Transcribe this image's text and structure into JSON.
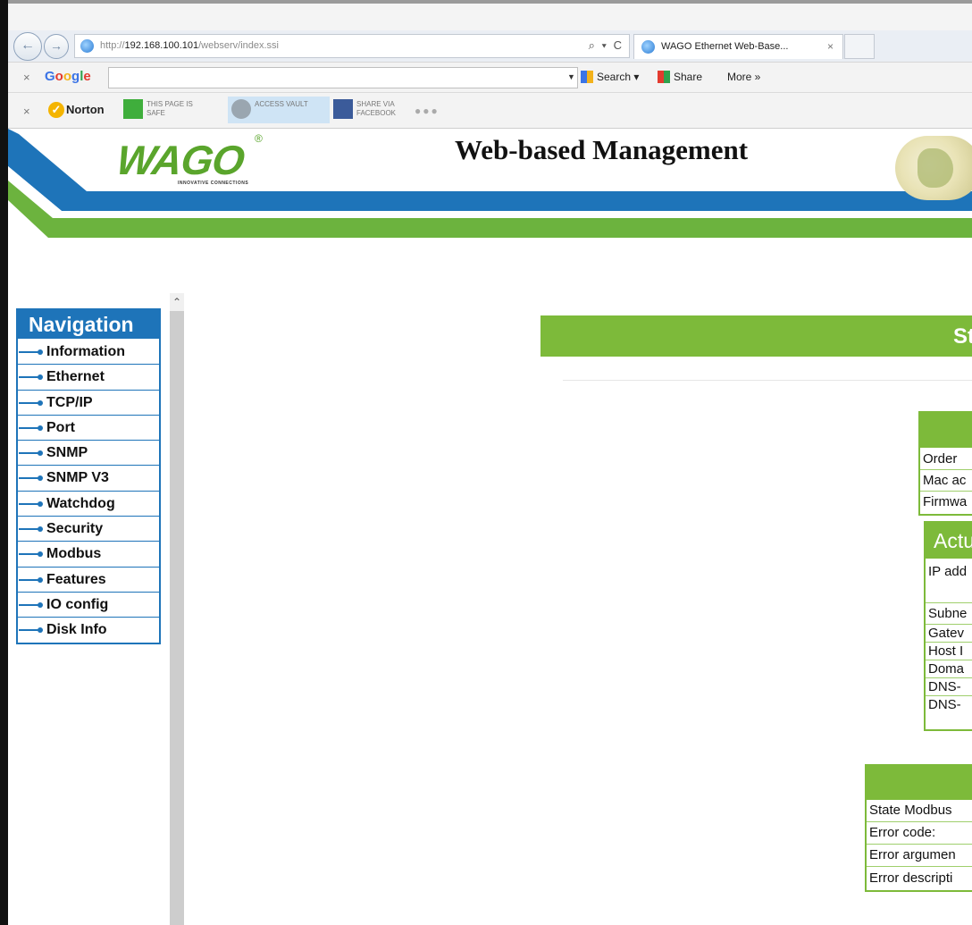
{
  "browser": {
    "url_prefix": "http://",
    "url_host": "192.168.100.101",
    "url_path": "/webserv/index.ssi",
    "url_controls": "⌕ ▾ C",
    "tab_title": "WAGO Ethernet Web-Base...",
    "tab_close": "×",
    "google_logo": [
      "G",
      "o",
      "o",
      "g",
      "l",
      "e"
    ],
    "google_search": "Search",
    "google_share": "Share",
    "google_more": "More »",
    "norton_label": "Norton",
    "norton_safe": "THIS PAGE IS SAFE",
    "norton_vault": "ACCESS VAULT",
    "norton_facebook": "SHARE VIA FACEBOOK",
    "close_x": "×"
  },
  "header": {
    "logo": "WAGO",
    "logo_reg": "®",
    "tagline": "INNOVATIVE CONNECTIONS",
    "title": "Web-based Management"
  },
  "navigation": {
    "title": "Navigation",
    "items": [
      "Information",
      "Ethernet",
      "TCP/IP",
      "Port",
      "SNMP",
      "SNMP V3",
      "Watchdog",
      "Security",
      "Modbus",
      "Features",
      "IO config",
      "Disk Info"
    ]
  },
  "content": {
    "section_title_partial": "St",
    "table1_rows": [
      "Order",
      "Mac ac",
      "Firmwa"
    ],
    "table2_header_partial": "Actu",
    "table2_rows": [
      "IP add",
      "Subne",
      "Gatev",
      "Host I",
      "Doma",
      "DNS-",
      "DNS-"
    ],
    "table3_rows": [
      "State Modbus",
      "Error code:",
      "Error argumen",
      "Error descripti"
    ]
  },
  "colors": {
    "nav_blue": "#1e74b9",
    "wago_green": "#7dba3a"
  }
}
